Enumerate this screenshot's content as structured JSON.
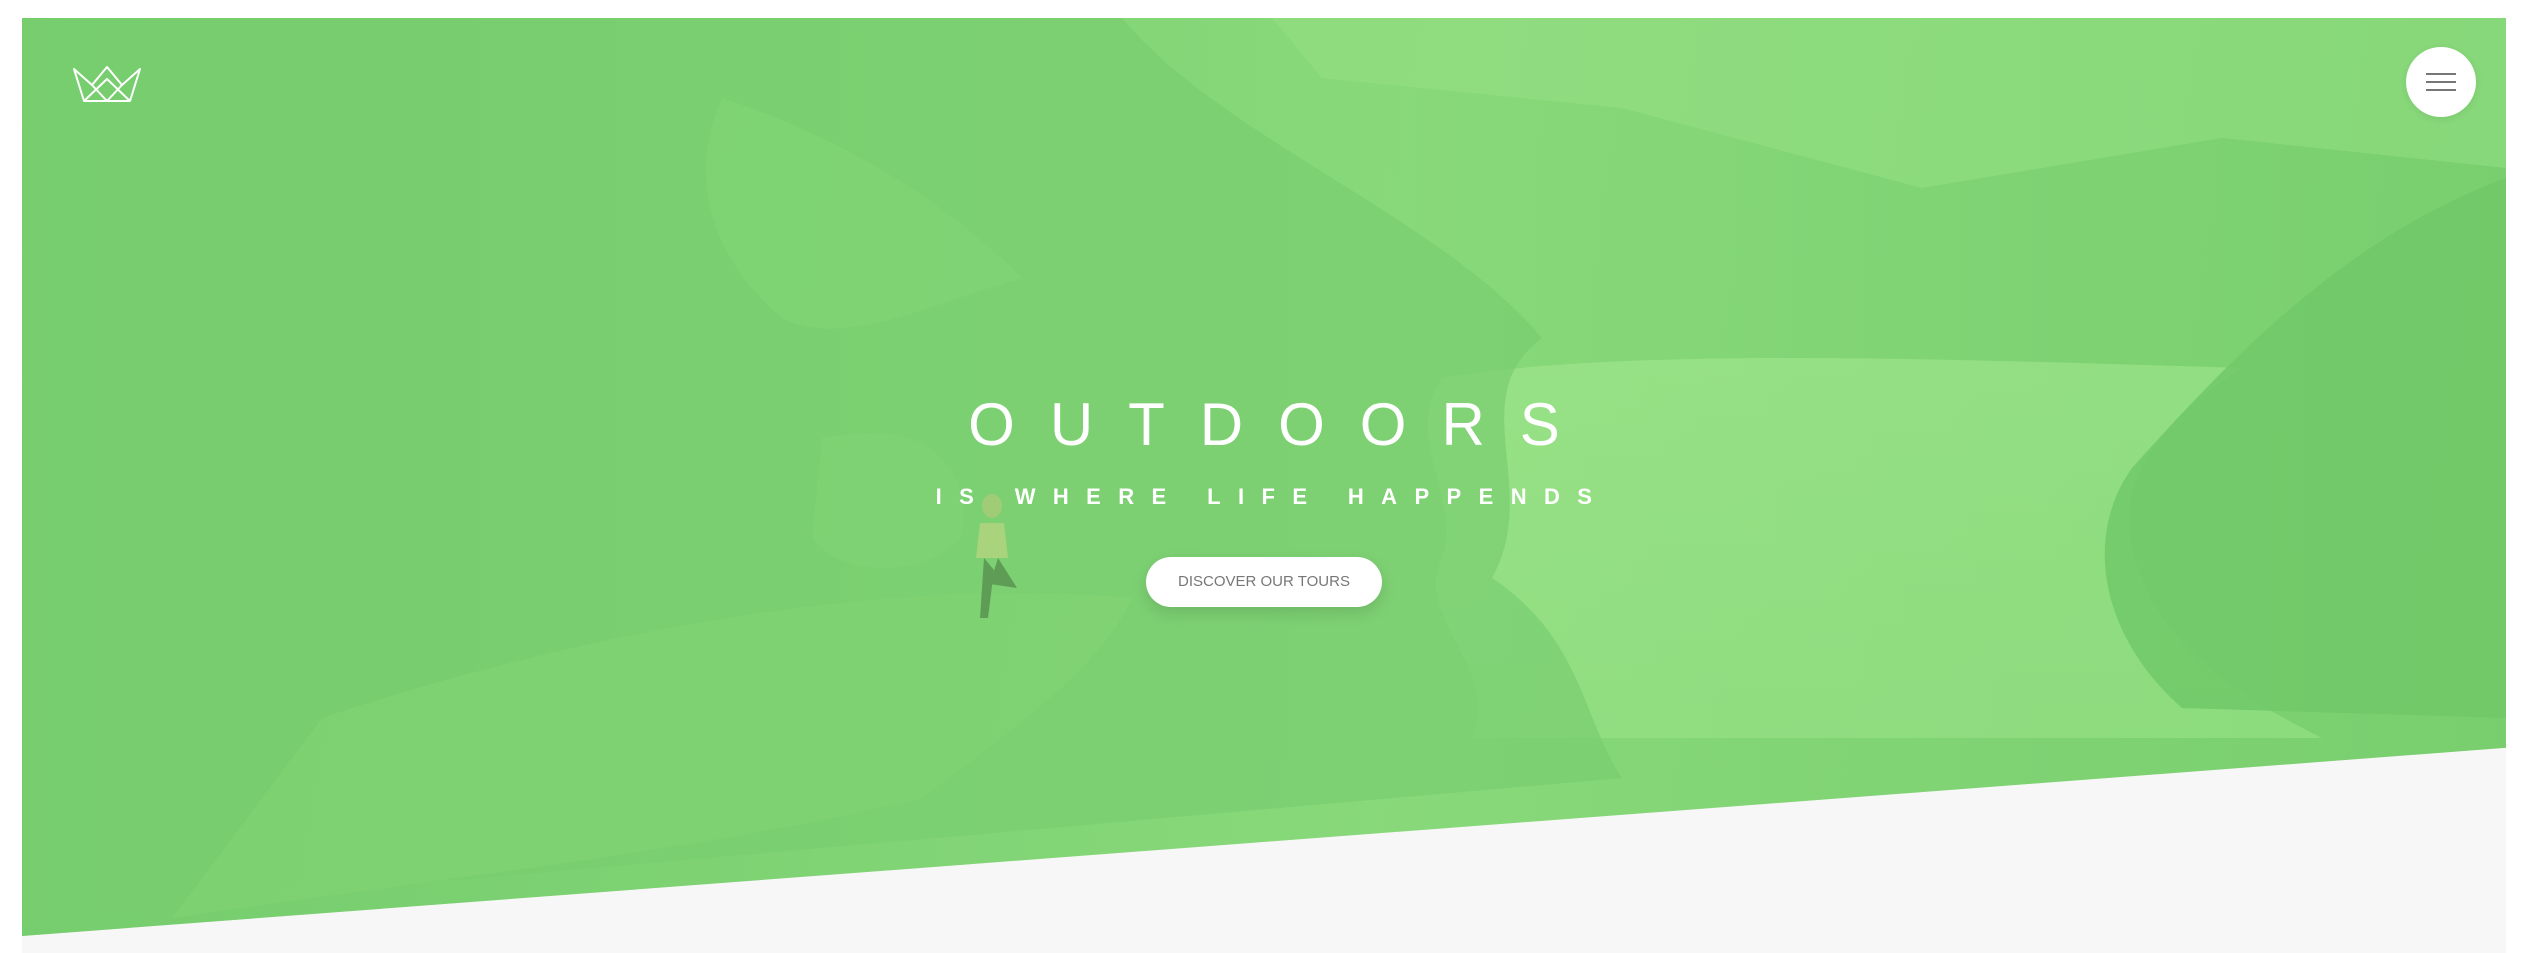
{
  "header": {
    "logo_icon": "crown-icon",
    "menu_icon": "hamburger-menu-icon"
  },
  "hero": {
    "title": "OUTDOORS",
    "subtitle": "IS WHERE LIFE HAPPENDS",
    "cta_label": "DISCOVER OUR TOURS"
  },
  "colors": {
    "accent": "#7ed56f",
    "accent_light": "#a2e596",
    "accent_dark": "#55c57a",
    "text_on_hero": "#ffffff",
    "button_text": "#777777",
    "page_background": "#f7f7f7"
  }
}
